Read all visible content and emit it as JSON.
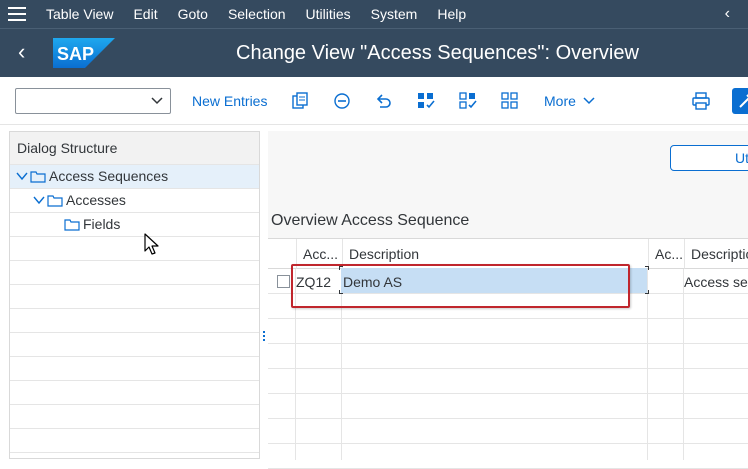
{
  "menu": {
    "items": [
      {
        "label": "Table View"
      },
      {
        "label": "Edit"
      },
      {
        "label": "Goto"
      },
      {
        "label": "Selection"
      },
      {
        "label": "Utilities"
      },
      {
        "label": "System"
      },
      {
        "label": "Help"
      }
    ]
  },
  "title": {
    "logo_text": "SAP",
    "page_title": "Change View \"Access Sequences\": Overview"
  },
  "toolbar": {
    "dropdown_value": "",
    "new_entries": "New Entries",
    "more": "More",
    "right_button": "Ut"
  },
  "dialog_structure": {
    "header": "Dialog Structure",
    "items": [
      {
        "label": "Access Sequences",
        "selected": true
      },
      {
        "label": "Accesses"
      },
      {
        "label": "Fields"
      }
    ]
  },
  "overview": {
    "section_title": "Overview Access Sequence",
    "columns": [
      "Acc...",
      "Description",
      "Ac...",
      "Descriptio"
    ],
    "rows": [
      {
        "access_sequence": "ZQ12",
        "description": "Demo AS",
        "access_type": "",
        "type_description": "Access sec"
      }
    ]
  },
  "colors": {
    "shell": "#354a5f",
    "accent": "#0a6ed1",
    "highlight": "#c0262d",
    "edit_cell": "#c6def4"
  }
}
